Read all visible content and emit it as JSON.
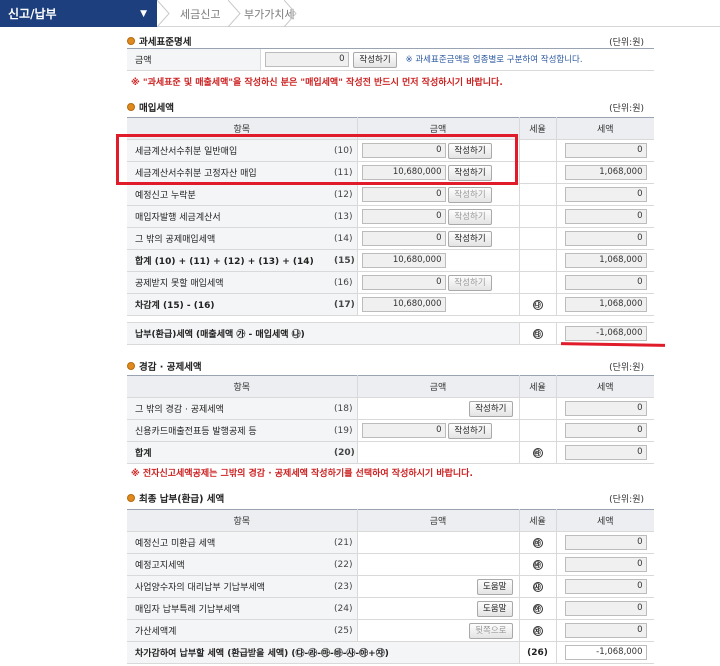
{
  "nav": {
    "main_menu": "신고/납부",
    "breadcrumb": [
      "세금신고",
      "부가가치세"
    ]
  },
  "unit": "(단위:원)",
  "tax_base": {
    "title": "과세표준명세",
    "label": "금액",
    "value": "0",
    "button": "작성하기",
    "note": "※ 과세표준금액을 업종별로 구분하여 작성합니다."
  },
  "warning1": "※ \"과세표준 및 매출세액\"을 작성하신 분은 \"매입세액\" 작성전 반드시 먼저 작성하시기 바랍니다.",
  "purchase": {
    "title": "매입세액",
    "headers": [
      "항목",
      "금액",
      "세율",
      "세액"
    ],
    "rows": [
      {
        "label": "세금계산서수취분 일반매입",
        "num": "(10)",
        "amount": "0",
        "button": "작성하기",
        "btn_disabled": false,
        "tax": "0"
      },
      {
        "label": "세금계산서수취분 고정자산 매입",
        "num": "(11)",
        "amount": "10,680,000",
        "button": "작성하기",
        "btn_disabled": false,
        "tax": "1,068,000"
      },
      {
        "label": "예정신고 누락분",
        "num": "(12)",
        "amount": "0",
        "button": "작성하기",
        "btn_disabled": true,
        "tax": "0"
      },
      {
        "label": "매입자발행 세금계산서",
        "num": "(13)",
        "amount": "0",
        "button": "작성하기",
        "btn_disabled": true,
        "tax": "0"
      },
      {
        "label": "그 밖의 공제매입세액",
        "num": "(14)",
        "amount": "0",
        "button": "작성하기",
        "btn_disabled": false,
        "tax": "0"
      },
      {
        "label": "합계 (10) + (11) + (12) + (13) + (14)",
        "num": "(15)",
        "amount": "10,680,000",
        "button": "",
        "btn_disabled": false,
        "tax": "1,068,000"
      },
      {
        "label": "공제받지 못할 매입세액",
        "num": "(16)",
        "amount": "0",
        "button": "작성하기",
        "btn_disabled": true,
        "tax": "0"
      },
      {
        "label": "차감계 (15) - (16)",
        "num": "(17)",
        "amount": "10,680,000",
        "button": "",
        "btn_disabled": false,
        "rate": "㉯",
        "tax": "1,068,000"
      }
    ],
    "payable_label": "납부(환급)세액 (매출세액 ㉮ - 매입세액 ㉯)",
    "payable_rate": "㉰",
    "payable_tax": "-1,068,000"
  },
  "reduction": {
    "title": "경감 · 공제세액",
    "headers": [
      "항목",
      "금액",
      "세율",
      "세액"
    ],
    "rows": [
      {
        "label": "그 밖의 경감 · 공제세액",
        "num": "(18)",
        "button": "작성하기",
        "tax": "0"
      },
      {
        "label": "신용카드매출전표등 발행공제 등",
        "num": "(19)",
        "amount": "0",
        "button": "작성하기",
        "tax": "0"
      },
      {
        "label": "합계",
        "num": "(20)",
        "rate": "㉱",
        "tax": "0"
      }
    ]
  },
  "warning2": "※ 전자신고세액공제는 그밖의 경감 · 공제세액 작성하기를 선택하여 작성하시기 바랍니다.",
  "final": {
    "title": "최종 납부(환급) 세액",
    "headers": [
      "항목",
      "금액",
      "세율",
      "세액"
    ],
    "rows": [
      {
        "label": "예정신고 미환급 세액",
        "num": "(21)",
        "button": "",
        "rate": "㉲",
        "tax": "0"
      },
      {
        "label": "예정고지세액",
        "num": "(22)",
        "button": "",
        "rate": "㉳",
        "tax": "0"
      },
      {
        "label": "사업양수자의 대리납부 기납부세액",
        "num": "(23)",
        "button": "도움말",
        "rate": "㉴",
        "tax": "0"
      },
      {
        "label": "매입자 납부특례 기납부세액",
        "num": "(24)",
        "button": "도움말",
        "rate": "㉵",
        "tax": "0"
      },
      {
        "label": "가산세액계",
        "num": "(25)",
        "button": "뒷쪽으로",
        "rate": "㉶",
        "tax": "0"
      }
    ],
    "total_label": "차가감하여 납부할 세액 (환급받을 세액) (㉰-㉱-㉲-㉳-㉴-㉵+㉶)",
    "total_num": "(26)",
    "total_tax": "-1,068,000"
  }
}
